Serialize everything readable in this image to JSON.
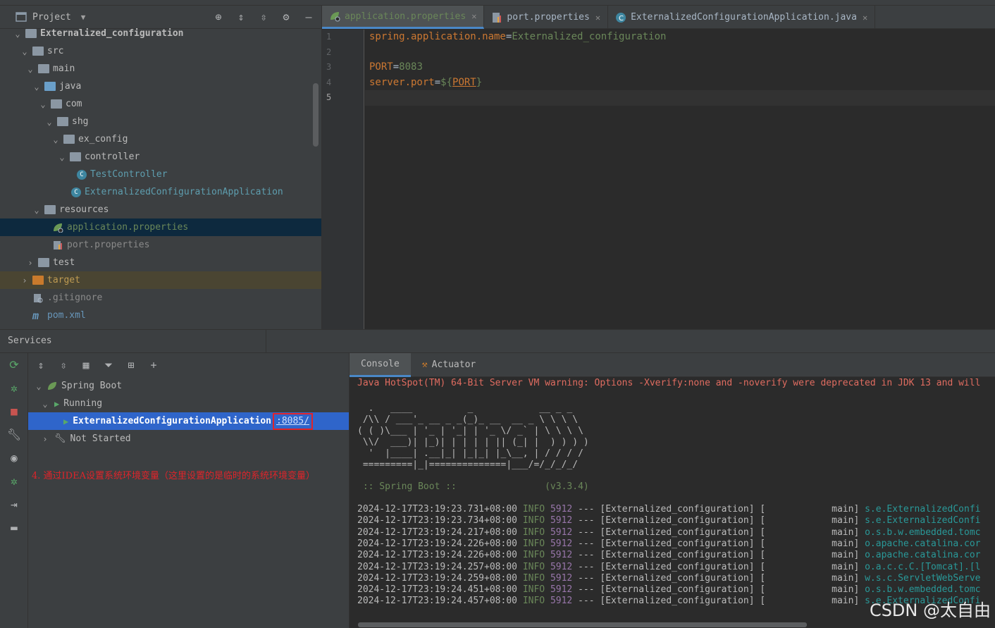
{
  "project": {
    "title": "Project",
    "tree": [
      {
        "label": "Externalized_configuration",
        "kind": "module",
        "level": 0
      },
      {
        "label": "src",
        "kind": "folder",
        "level": 1
      },
      {
        "label": "main",
        "kind": "folder",
        "level": 2
      },
      {
        "label": "java",
        "kind": "folder-blue",
        "level": 3
      },
      {
        "label": "com",
        "kind": "package",
        "level": 4
      },
      {
        "label": "shg",
        "kind": "package",
        "level": 5
      },
      {
        "label": "ex_config",
        "kind": "package",
        "level": 6
      },
      {
        "label": "controller",
        "kind": "package",
        "level": 7
      },
      {
        "label": "TestController",
        "kind": "class",
        "level": 8
      },
      {
        "label": "ExternalizedConfigurationApplication",
        "kind": "spring-class",
        "level": 7
      },
      {
        "label": "resources",
        "kind": "folder-res",
        "level": 3
      },
      {
        "label": "application.properties",
        "kind": "spring-props",
        "level": 4
      },
      {
        "label": "port.properties",
        "kind": "props",
        "level": 4
      },
      {
        "label": "test",
        "kind": "folder",
        "level": 2
      },
      {
        "label": "target",
        "kind": "folder-orange",
        "level": 1
      },
      {
        "label": ".gitignore",
        "kind": "file",
        "level": 1
      },
      {
        "label": "pom.xml",
        "kind": "maven",
        "level": 1
      }
    ]
  },
  "editor": {
    "tabs": [
      {
        "label": "application.properties",
        "active": true
      },
      {
        "label": "port.properties",
        "active": false
      },
      {
        "label": "ExternalizedConfigurationApplication.java",
        "active": false
      }
    ],
    "line_numbers": [
      "1",
      "2",
      "3",
      "4",
      "5"
    ],
    "lines": {
      "l1_key": "spring.application.name",
      "l1_eq": "=",
      "l1_val": "Externalized_configuration",
      "l3_key": "PORT",
      "l3_eq": "=",
      "l3_val": "8083",
      "l4_key": "server.port",
      "l4_eq": "=",
      "l4_open": "${",
      "l4_ref": "PORT",
      "l4_close": "}"
    }
  },
  "services": {
    "title": "Services",
    "spring_boot": "Spring Boot",
    "running": "Running",
    "app": "ExternalizedConfigurationApplication",
    "port": ":8085/",
    "not_started": "Not Started",
    "annotation": "4. 通过IDEA设置系统环境变量（这里设置的是临时的系统环境变量）"
  },
  "console": {
    "tabs": [
      "Console",
      "Actuator"
    ],
    "warning": "Java HotSpot(TM) 64-Bit Server VM warning: Options -Xverify:none and -noverify were deprecated in JDK 13 and will",
    "banner": [
      "  .   ____          _            __ _ _",
      " /\\\\ / ___'_ __ _ _(_)_ __  __ _ \\ \\ \\ \\",
      "( ( )\\___ | '_ | '_| | '_ \\/ _` | \\ \\ \\ \\",
      " \\\\/  ___)| |_)| | | | | || (_| |  ) ) ) )",
      "  '  |____| .__|_| |_|_| |_\\__, | / / / /",
      " =========|_|==============|___/=/_/_/_/"
    ],
    "spring_boot_line": " :: Spring Boot ::                (v3.3.4)",
    "logs": [
      {
        "ts": "2024-12-17T23:19:23.731+08:00",
        "lvl": "INFO",
        "pid": "5912",
        "sep": "---",
        "app": "[Externalized_configuration] [",
        "thread": "           main]",
        "cls": "s.e.ExternalizedConfi"
      },
      {
        "ts": "2024-12-17T23:19:23.734+08:00",
        "lvl": "INFO",
        "pid": "5912",
        "sep": "---",
        "app": "[Externalized_configuration] [",
        "thread": "           main]",
        "cls": "s.e.ExternalizedConfi"
      },
      {
        "ts": "2024-12-17T23:19:24.217+08:00",
        "lvl": "INFO",
        "pid": "5912",
        "sep": "---",
        "app": "[Externalized_configuration] [",
        "thread": "           main]",
        "cls": "o.s.b.w.embedded.tomc"
      },
      {
        "ts": "2024-12-17T23:19:24.226+08:00",
        "lvl": "INFO",
        "pid": "5912",
        "sep": "---",
        "app": "[Externalized_configuration] [",
        "thread": "           main]",
        "cls": "o.apache.catalina.cor"
      },
      {
        "ts": "2024-12-17T23:19:24.226+08:00",
        "lvl": "INFO",
        "pid": "5912",
        "sep": "---",
        "app": "[Externalized_configuration] [",
        "thread": "           main]",
        "cls": "o.apache.catalina.cor"
      },
      {
        "ts": "2024-12-17T23:19:24.257+08:00",
        "lvl": "INFO",
        "pid": "5912",
        "sep": "---",
        "app": "[Externalized_configuration] [",
        "thread": "           main]",
        "cls": "o.a.c.c.C.[Tomcat].[l"
      },
      {
        "ts": "2024-12-17T23:19:24.259+08:00",
        "lvl": "INFO",
        "pid": "5912",
        "sep": "---",
        "app": "[Externalized_configuration] [",
        "thread": "           main]",
        "cls": "w.s.c.ServletWebServe"
      },
      {
        "ts": "2024-12-17T23:19:24.451+08:00",
        "lvl": "INFO",
        "pid": "5912",
        "sep": "---",
        "app": "[Externalized_configuration] [",
        "thread": "           main]",
        "cls": "o.s.b.w.embedded.tomc"
      },
      {
        "ts": "2024-12-17T23:19:24.457+08:00",
        "lvl": "INFO",
        "pid": "5912",
        "sep": "---",
        "app": "[Externalized_configuration] [",
        "thread": "           main]",
        "cls": "s.e.ExternalizedConfi"
      }
    ]
  },
  "watermark": "CSDN @太自由",
  "colors": {
    "accent": "#4a88c7",
    "selection": "#2f65ca",
    "annotation_red": "#e0242a"
  }
}
